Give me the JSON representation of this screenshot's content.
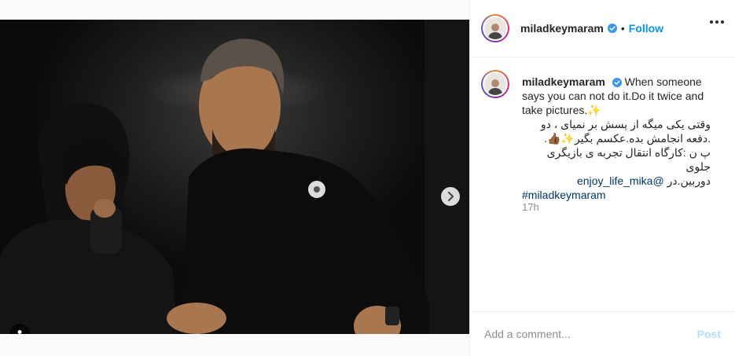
{
  "author": {
    "username": "miladkeymaram",
    "verified": true,
    "follow_label": "Follow",
    "separator": "•"
  },
  "caption": {
    "username": "miladkeymaram",
    "text_en": "When someone says you can not do it.Do it twice and take pictures.",
    "sparkle_emoji": "✨",
    "line_fa_1": "وقتی یکی میگه از پسش بر نمیای ، دو",
    "line_fa_2_prefix": ".",
    "line_fa_2_emojis": "✨👍🏾",
    "line_fa_2_text": ".دفعه انجامش بده.عکسم بگیر",
    "line_fa_3": "پ ن :کارگاه انتقال تجربه ی بازیگری جلوی",
    "line_fa_4_text": "دوربین.در",
    "mention": "@enjoy_life_mika",
    "hashtag": "#miladkeymaram"
  },
  "timestamp": "17h",
  "comment": {
    "placeholder": "Add a comment...",
    "post_label": "Post"
  },
  "carousel": {
    "slide_count": 4,
    "current_slide": 1
  },
  "icons": {
    "verified": "verified-badge-icon",
    "more": "more-options-icon",
    "next": "chevron-right-icon",
    "tag": "user-tag-icon"
  },
  "colors": {
    "accent": "#0095f6",
    "verified": "#3897f0",
    "text": "#262626",
    "muted": "#8e8e8e",
    "link": "#00376b",
    "post_disabled": "#b2dffc"
  }
}
